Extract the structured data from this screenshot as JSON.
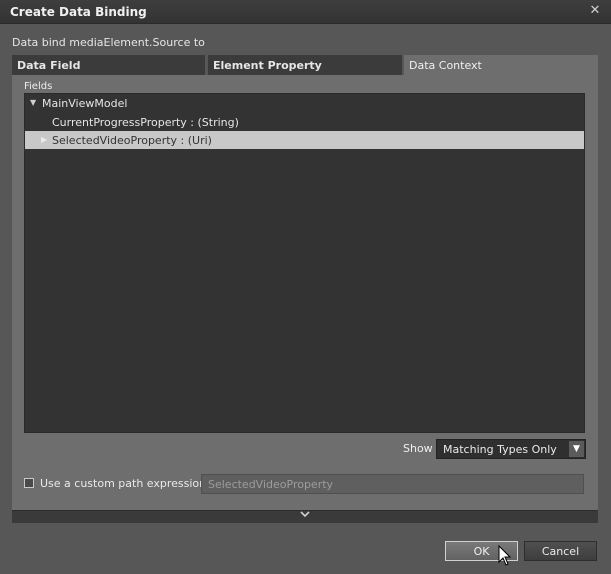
{
  "window": {
    "title": "Create Data Binding",
    "close_glyph": "✕"
  },
  "subtitle": "Data bind mediaElement.Source to",
  "tabs": [
    {
      "label": "Data Field",
      "active": false
    },
    {
      "label": "Element Property",
      "active": false
    },
    {
      "label": "Data Context",
      "active": true
    }
  ],
  "fields": {
    "label": "Fields",
    "tree": [
      {
        "label": "MainViewModel",
        "expanded": true,
        "level": 0
      },
      {
        "label": "CurrentProgressProperty : (String)",
        "level": 1
      },
      {
        "label": "SelectedVideoProperty : (Uri)",
        "level": 1,
        "selected": true
      }
    ]
  },
  "show": {
    "label": "Show",
    "selected": "Matching Types Only"
  },
  "custom_path": {
    "checkbox_label": "Use a custom path expression",
    "checked": false,
    "value": "SelectedVideoProperty"
  },
  "buttons": {
    "ok": "OK",
    "cancel": "Cancel"
  },
  "icons": {
    "expanded_arrow": "▼",
    "collapsed_arrow": "▶",
    "dropdown": "▼",
    "expander": "⌄"
  },
  "colors": {
    "background": "#575757",
    "titlebar": "#333333",
    "tree_bg": "#333333",
    "selected_row": "#c8c8c8"
  }
}
